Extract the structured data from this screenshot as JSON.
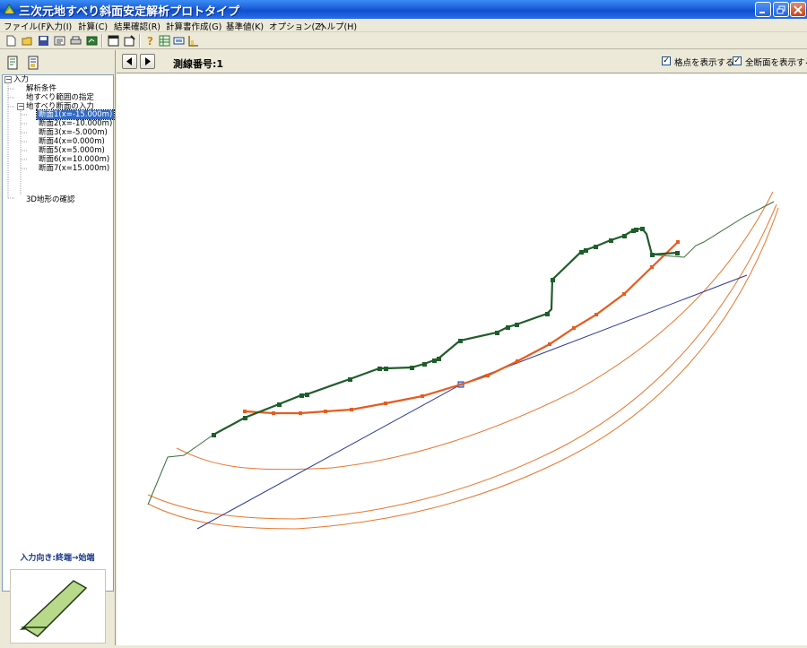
{
  "window": {
    "title": "三次元地すべり斜面安定解析プロトタイプ",
    "title_bar_color": "#1c5fd8"
  },
  "menu": [
    {
      "label": "ファイル(F)"
    },
    {
      "label": "入力(I)"
    },
    {
      "label": "計算(C)"
    },
    {
      "label": "結果確認(R)"
    },
    {
      "label": "計算書作成(G)"
    },
    {
      "label": "基準値(K)"
    },
    {
      "label": "オプション(Z)"
    },
    {
      "label": "ヘルプ(H)"
    }
  ],
  "toolbar": {
    "icons": [
      "new-file-icon",
      "open-folder-icon",
      "save-icon",
      "import-icon",
      "print-icon",
      "export-icon",
      "window-icon",
      "settings-icon",
      "help-icon",
      "table-icon",
      "screen-icon",
      "chart-icon"
    ]
  },
  "tree": {
    "items": [
      {
        "label": "入力",
        "level": 0,
        "toggle": "−"
      },
      {
        "label": "解析条件",
        "level": 1
      },
      {
        "label": "地すべり範囲の指定",
        "level": 1
      },
      {
        "label": "地すべり断面の入力",
        "level": 1,
        "toggle": "−"
      },
      {
        "label": "断面1(x=-15.000m)",
        "level": 2,
        "selected": true
      },
      {
        "label": "断面2(x=-10.000m)",
        "level": 2
      },
      {
        "label": "断面3(x=-5.000m)",
        "level": 2
      },
      {
        "label": "断面4(x=0.000m)",
        "level": 2
      },
      {
        "label": "断面5(x=5.000m)",
        "level": 2
      },
      {
        "label": "断面6(x=10.000m)",
        "level": 2
      },
      {
        "label": "断面7(x=15.000m)",
        "level": 2
      },
      {
        "label": "3D地形の確認",
        "level": 1
      }
    ]
  },
  "direction_label": "入力向き:終端→始端",
  "nav": {
    "survey_label": "測線番号:1",
    "show_grid": {
      "label": "格点を表示する",
      "checked": true
    },
    "show_all_sections": {
      "label": "全断面を表示する",
      "checked": true
    }
  },
  "colors": {
    "ground_line": "#1e5e2a",
    "slip_line": "#e85a1e",
    "slip_arcs": "#e8772e",
    "axis_line": "#2a3a9a",
    "thin_ground": "#3a6e3a",
    "selection": "#316ac5"
  },
  "drawing": {
    "series": [
      {
        "name": "ground-surface",
        "kind": "green-polyline-with-nodes"
      },
      {
        "name": "slip-surface",
        "kind": "orange-polyline-with-nodes"
      },
      {
        "name": "section-arcs",
        "kind": "orange-curves"
      },
      {
        "name": "section-axis",
        "kind": "blue-line"
      }
    ]
  }
}
